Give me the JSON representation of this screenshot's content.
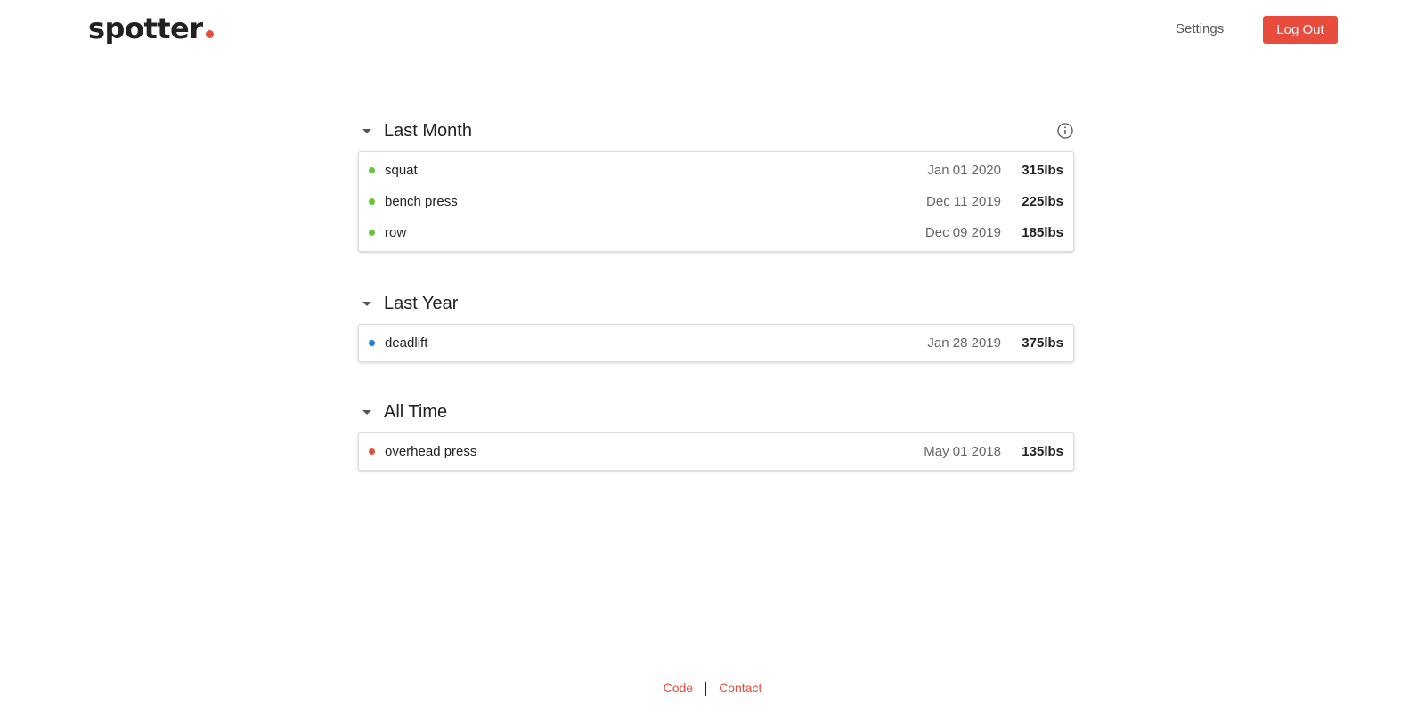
{
  "brand": {
    "name": "spotter",
    "accent_color": "#e84c3d"
  },
  "header": {
    "settings_label": "Settings",
    "logout_label": "Log Out"
  },
  "sections": [
    {
      "title": "Last Month",
      "dot_color": "#66c53b",
      "has_info_icon": true,
      "rows": [
        {
          "name": "squat",
          "date": "Jan 01 2020",
          "weight": "315lbs"
        },
        {
          "name": "bench press",
          "date": "Dec 11 2019",
          "weight": "225lbs"
        },
        {
          "name": "row",
          "date": "Dec 09 2019",
          "weight": "185lbs"
        }
      ]
    },
    {
      "title": "Last Year",
      "dot_color": "#1f7fe0",
      "rows": [
        {
          "name": "deadlift",
          "date": "Jan 28 2019",
          "weight": "375lbs"
        }
      ]
    },
    {
      "title": "All Time",
      "dot_color": "#e84c3d",
      "rows": [
        {
          "name": "overhead press",
          "date": "May 01 2018",
          "weight": "135lbs"
        }
      ]
    }
  ],
  "footer": {
    "code_label": "Code",
    "contact_label": "Contact"
  },
  "icons": {
    "collapse": "caret-down-icon",
    "info": "info-icon"
  }
}
